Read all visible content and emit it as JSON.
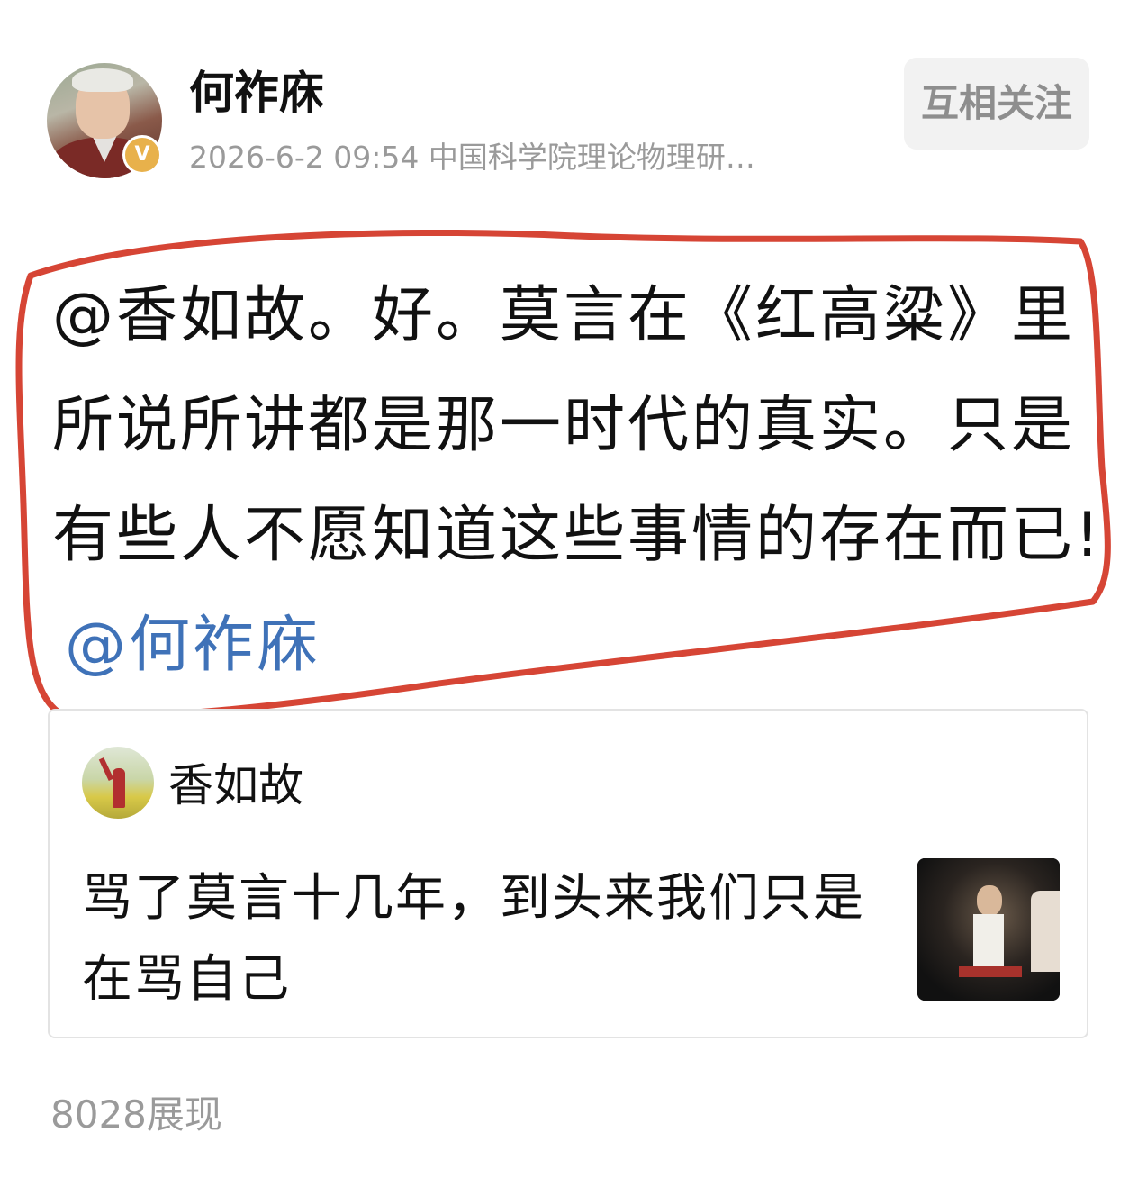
{
  "post": {
    "author_name": "何祚庥",
    "meta": "2026-6-2 09:54 中国科学院理论物理研…",
    "verified_badge": "V",
    "follow_label": "互相关注",
    "text": "@香如故。好。莫言在《红高粱》里所说所讲都是那一时代的真实。只是有些人不愿知道这些事情的存在而已!",
    "mention": "@何祚庥",
    "views": "8028展现"
  },
  "quoted_post": {
    "author_name": "香如故",
    "text": "骂了莫言十几年，到头来我们只是在骂自己"
  },
  "colors": {
    "mention": "#3f72b8",
    "highlight_loop": "#d64535",
    "follow_button_bg": "#f2f2f2",
    "meta_text": "#9a9a9a",
    "verified_badge": "#e8b14b"
  },
  "icons": {
    "verified": "verified-v-badge-icon"
  }
}
